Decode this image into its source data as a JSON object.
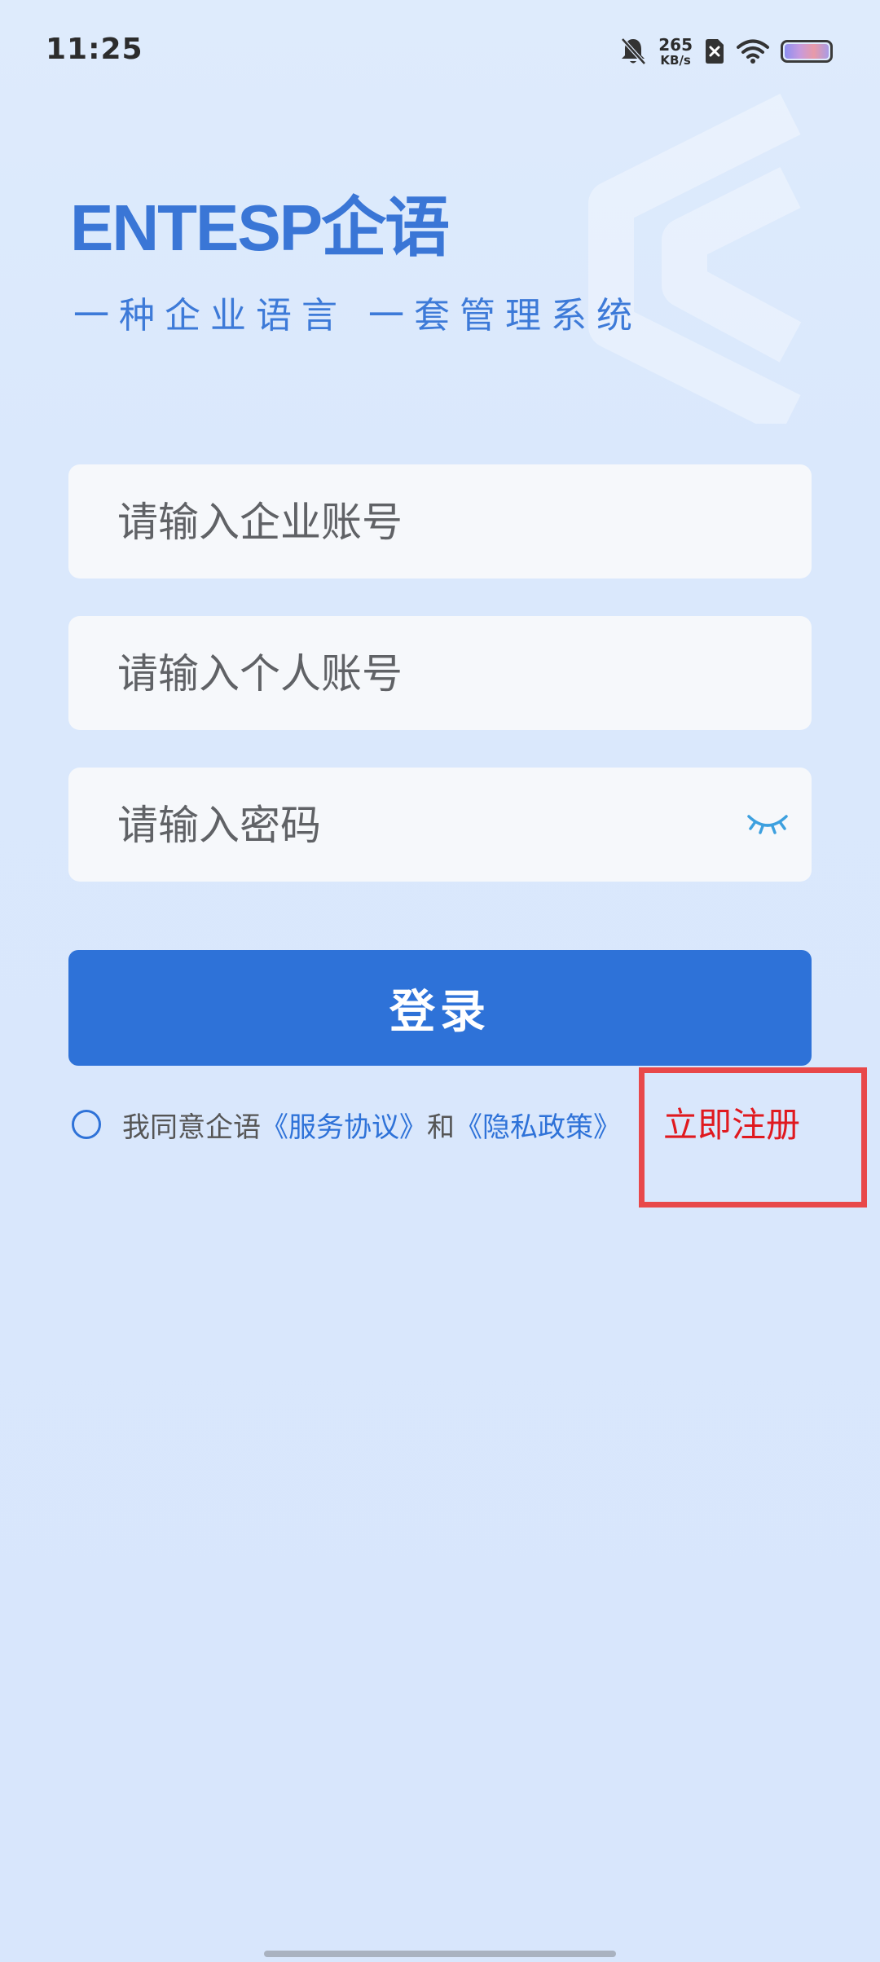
{
  "status_bar": {
    "time": "11:25",
    "net_speed_value": "265",
    "net_speed_unit": "KB/s"
  },
  "brand": {
    "title": "ENTESP企语",
    "subtitle": "一种企业语言 一套管理系统"
  },
  "form": {
    "company_account_placeholder": "请输入企业账号",
    "personal_account_placeholder": "请输入个人账号",
    "password_placeholder": "请输入密码",
    "login_label": "登录"
  },
  "agreement": {
    "prefix": "我同意企语",
    "service_link": "《服务协议》",
    "conjunction": "和",
    "privacy_link": "《隐私政策》"
  },
  "register": {
    "label": "立即注册"
  },
  "colors": {
    "primary": "#2e72d8",
    "brand": "#3a76d6",
    "register": "#e0191f",
    "highlight_box": "#e8484a"
  }
}
